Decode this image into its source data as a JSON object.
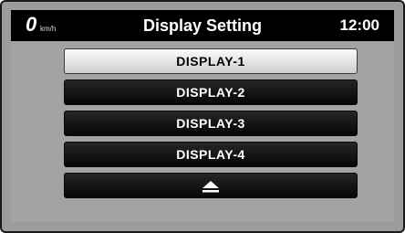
{
  "header": {
    "speed_value": "0",
    "speed_unit": "km/h",
    "title": "Display Setting",
    "clock": "12:00"
  },
  "menu": {
    "items": [
      {
        "label": "DISPLAY-1",
        "selected": true
      },
      {
        "label": "DISPLAY-2",
        "selected": false
      },
      {
        "label": "DISPLAY-3",
        "selected": false
      },
      {
        "label": "DISPLAY-4",
        "selected": false
      }
    ],
    "up_icon": "eject-icon"
  },
  "colors": {
    "header_bg": "#000000",
    "screen_bg": "#a3a3a3",
    "button_bg": "#111111",
    "button_selected_bg": "#e6e6e6"
  }
}
